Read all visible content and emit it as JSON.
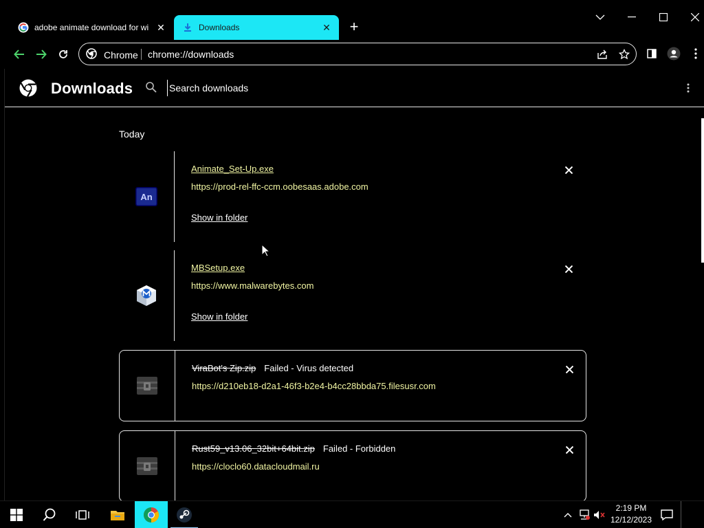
{
  "tabs": [
    {
      "title": "adobe animate download for wi",
      "active": false
    },
    {
      "title": "Downloads",
      "active": true
    }
  ],
  "omnibox": {
    "site_label": "Chrome",
    "url": "chrome://downloads"
  },
  "downloads_page": {
    "title": "Downloads",
    "search_placeholder": "Search downloads",
    "section_label": "Today",
    "items": [
      {
        "filename": "Animate_Set-Up.exe",
        "status": "",
        "url": "https://prod-rel-ffc-ccm.oobesaas.adobe.com",
        "action": "Show in folder",
        "icon": "adobe-animate-icon",
        "icon_text": "An"
      },
      {
        "filename": "MBSetup.exe",
        "status": "",
        "url": "https://www.malwarebytes.com",
        "action": "Show in folder",
        "icon": "malwarebytes-icon"
      },
      {
        "filename": "ViraBot's Zip.zip",
        "status": "Failed - Virus detected",
        "url": "https://d210eb18-d2a1-46f3-b2e4-b4cc28bbda75.filesusr.com",
        "icon": "archive-icon"
      },
      {
        "filename": "Rust59_v13.06_32bit+64bit.zip",
        "status": "Failed - Forbidden",
        "url": "https://cloclo60.datacloudmail.ru",
        "icon": "archive-icon"
      }
    ]
  },
  "taskbar": {
    "time": "2:19 PM",
    "date": "12/12/2023"
  },
  "colors": {
    "accent": "#1ce7f5",
    "link": "#f1f5a3",
    "background": "#000000"
  }
}
